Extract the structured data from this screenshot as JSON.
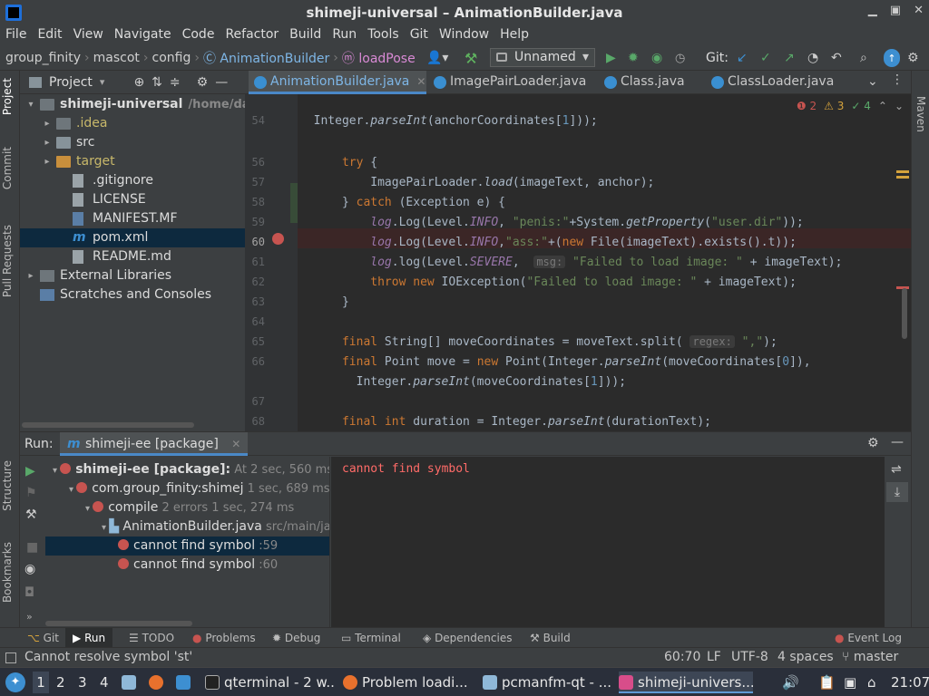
{
  "window": {
    "title": "shimeji-universal – AnimationBuilder.java"
  },
  "menu": [
    "File",
    "Edit",
    "View",
    "Navigate",
    "Code",
    "Refactor",
    "Build",
    "Run",
    "Tools",
    "Git",
    "Window",
    "Help"
  ],
  "breadcrumb": [
    "group_finity",
    "mascot",
    "config",
    "AnimationBuilder",
    "loadPose"
  ],
  "toolbar": {
    "run_config": "Unnamed",
    "git_label": "Git:"
  },
  "project": {
    "header": "Project",
    "tree": [
      {
        "label": "shimeji-universal",
        "extra": "/home/dartz",
        "indent": 0,
        "arrow": "▾",
        "icon": "folder-gray",
        "bold": true
      },
      {
        "label": ".idea",
        "indent": 1,
        "arrow": "▸",
        "icon": "folder-gray",
        "color": "#c8b86a"
      },
      {
        "label": "src",
        "indent": 1,
        "arrow": "▸",
        "icon": "folder"
      },
      {
        "label": "target",
        "indent": 1,
        "arrow": "▸",
        "icon": "folder-orange",
        "color": "#c8b86a"
      },
      {
        "label": ".gitignore",
        "indent": 2,
        "arrow": "",
        "icon": "file"
      },
      {
        "label": "LICENSE",
        "indent": 2,
        "arrow": "",
        "icon": "file"
      },
      {
        "label": "MANIFEST.MF",
        "indent": 2,
        "arrow": "",
        "icon": "mf"
      },
      {
        "label": "pom.xml",
        "indent": 2,
        "arrow": "",
        "icon": "maven",
        "selected": true
      },
      {
        "label": "README.md",
        "indent": 2,
        "arrow": "",
        "icon": "file"
      },
      {
        "label": "External Libraries",
        "indent": 0,
        "arrow": "▸",
        "icon": "lib"
      },
      {
        "label": "Scratches and Consoles",
        "indent": 0,
        "arrow": "",
        "icon": "scratch"
      }
    ]
  },
  "editor": {
    "tabs": [
      {
        "label": "AnimationBuilder.java",
        "active": true
      },
      {
        "label": "ImagePairLoader.java"
      },
      {
        "label": "Class.java"
      },
      {
        "label": "ClassLoader.java"
      }
    ],
    "inspections": {
      "errors": "2",
      "warnings": "3",
      "ok": "4"
    },
    "line_numbers": [
      "54",
      "56",
      "57",
      "58",
      "59",
      "60",
      "61",
      "62",
      "63",
      "64",
      "65",
      "66",
      "67",
      "68",
      "69"
    ],
    "hint_msg": "msg:",
    "hint_regex": "regex:"
  },
  "run": {
    "label": "Run:",
    "tab": "shimeji-ee [package]",
    "tree": [
      {
        "label": "shimeji-ee [package]:",
        "extra": "At",
        "time": "2 sec, 560 ms",
        "indent": 0,
        "bold": true
      },
      {
        "label": "com.group_finity:shimej",
        "time": "1 sec, 689 ms",
        "indent": 1
      },
      {
        "label": "compile",
        "extra": "2 errors",
        "time": "1 sec, 274 ms",
        "indent": 2
      },
      {
        "label": "AnimationBuilder.java",
        "extra": "src/main/ja",
        "indent": 3,
        "file": true
      },
      {
        "label": "cannot find symbol",
        "extra": ":59",
        "indent": 4,
        "selected": true
      },
      {
        "label": "cannot find symbol",
        "extra": ":60",
        "indent": 4
      }
    ],
    "output": "cannot find symbol"
  },
  "bottom_tabs": [
    "Git",
    "Run",
    "TODO",
    "Problems",
    "Debug",
    "Terminal",
    "Dependencies",
    "Build"
  ],
  "event_log": "Event Log",
  "status": {
    "message": "Cannot resolve symbol 'st'",
    "position": "60:70",
    "line_sep": "LF",
    "encoding": "UTF-8",
    "indent": "4 spaces",
    "branch": "master"
  },
  "side_labels": {
    "project": "Project",
    "commit": "Commit",
    "pull": "Pull Requests",
    "structure": "Structure",
    "bookmarks": "Bookmarks",
    "maven": "Maven"
  },
  "taskbar": {
    "workspaces": [
      "1",
      "2",
      "3",
      "4"
    ],
    "tasks": [
      "qterminal - 2 w...",
      "Problem loadi...",
      "pcmanfm-qt - ...",
      "shimeji-univers..."
    ],
    "clock": "21:07"
  }
}
